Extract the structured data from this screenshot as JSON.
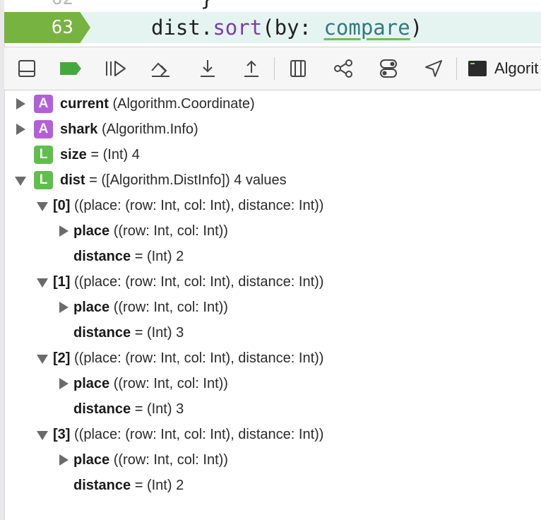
{
  "editor": {
    "prev_line_number": "62",
    "prev_line_code": "    }",
    "current_line_number": "63",
    "code": {
      "receiver": "dist.",
      "method": "sort",
      "open": "(by: ",
      "arg": "compare",
      "close": ")"
    }
  },
  "toolbar": {
    "buttons": [
      {
        "name": "hide-debug-area-icon"
      },
      {
        "name": "breakpoints-toggle-icon"
      },
      {
        "name": "continue-icon"
      },
      {
        "name": "step-over-icon"
      },
      {
        "name": "step-into-icon"
      },
      {
        "name": "step-out-icon"
      },
      {
        "name": "view-hierarchy-icon"
      },
      {
        "name": "memory-graph-icon"
      },
      {
        "name": "environment-overrides-icon"
      },
      {
        "name": "simulate-location-icon"
      }
    ],
    "target_label": "Algorit"
  },
  "variables": [
    {
      "expand": "closed",
      "badge": "A",
      "name": "current",
      "sep": "",
      "type": "(Algorithm.Coordinate)",
      "value": ""
    },
    {
      "expand": "closed",
      "badge": "A",
      "name": "shark",
      "sep": "",
      "type": "(Algorithm.Info)",
      "value": ""
    },
    {
      "expand": "none",
      "badge": "L",
      "name": "size",
      "sep": " = ",
      "type": "(Int)",
      "value": "4"
    },
    {
      "expand": "open",
      "badge": "L",
      "name": "dist",
      "sep": " = ",
      "type": "([Algorithm.DistInfo])",
      "value": "4 values"
    },
    {
      "name": "[0]",
      "type": "((place: (row: Int, col: Int), distance: Int))"
    },
    {
      "name": "place",
      "type": "((row: Int, col: Int))"
    },
    {
      "name": "distance",
      "sep": " = ",
      "type": "(Int)",
      "value": "2"
    },
    {
      "name": "[1]",
      "type": "((place: (row: Int, col: Int), distance: Int))"
    },
    {
      "name": "place",
      "type": "((row: Int, col: Int))"
    },
    {
      "name": "distance",
      "sep": " = ",
      "type": "(Int)",
      "value": "3"
    },
    {
      "name": "[2]",
      "type": "((place: (row: Int, col: Int), distance: Int))"
    },
    {
      "name": "place",
      "type": "((row: Int, col: Int))"
    },
    {
      "name": "distance",
      "sep": " = ",
      "type": "(Int)",
      "value": "3"
    },
    {
      "name": "[3]",
      "type": "((place: (row: Int, col: Int), distance: Int))"
    },
    {
      "name": "place",
      "type": "((row: Int, col: Int))"
    },
    {
      "name": "distance",
      "sep": " = ",
      "type": "(Int)",
      "value": "2"
    }
  ]
}
